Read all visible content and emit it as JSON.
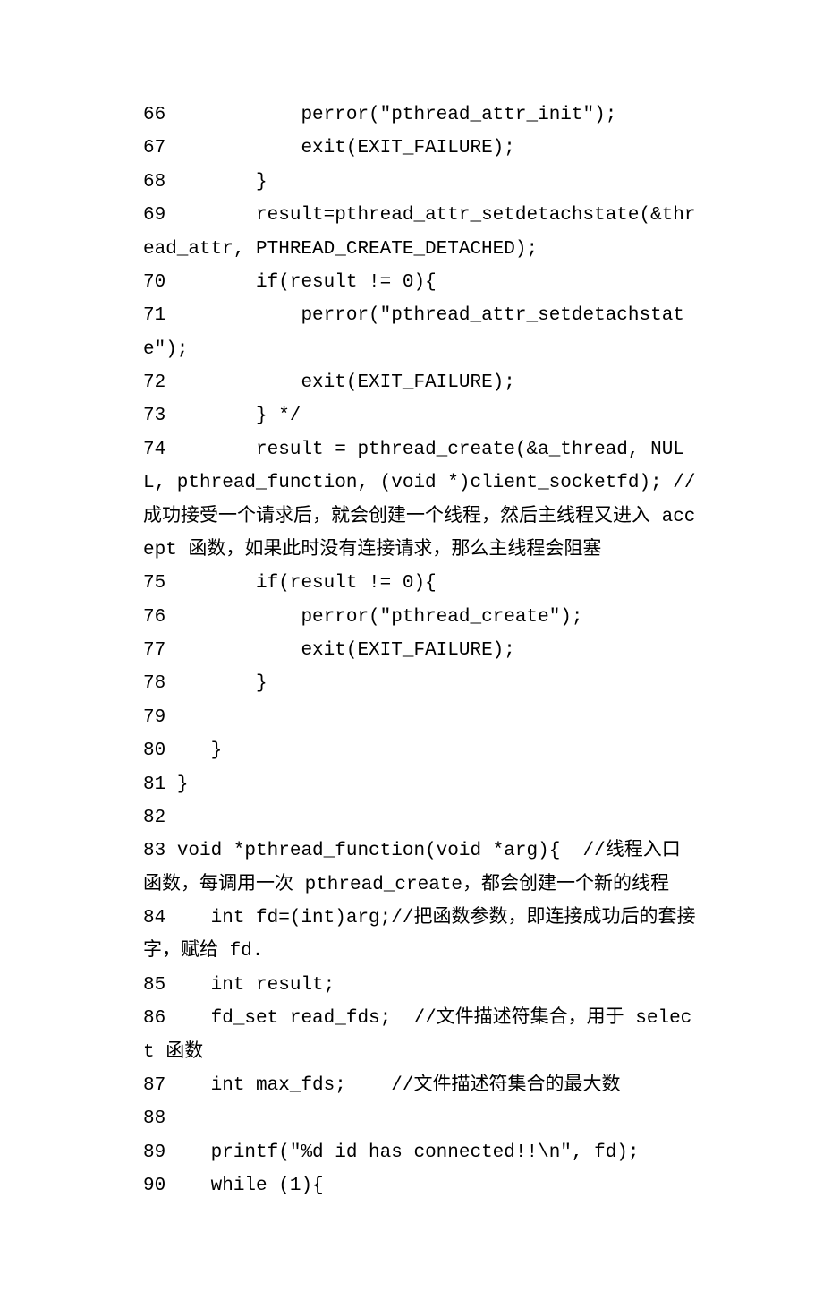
{
  "lines": [
    {
      "n": "66",
      "text": "            perror(\"pthread_attr_init\");"
    },
    {
      "n": "67",
      "text": "            exit(EXIT_FAILURE);"
    },
    {
      "n": "68",
      "text": "        }"
    },
    {
      "n": "69",
      "text": "        result=pthread_attr_setdetachstate(&thread_attr, PTHREAD_CREATE_DETACHED);"
    },
    {
      "n": "70",
      "text": "        if(result != 0){"
    },
    {
      "n": "71",
      "text": "            perror(\"pthread_attr_setdetachstate\");"
    },
    {
      "n": "72",
      "text": "            exit(EXIT_FAILURE);"
    },
    {
      "n": "73",
      "text": "        } */"
    },
    {
      "n": "74",
      "text": "        result = pthread_create(&a_thread, NULL, pthread_function, (void *)client_socketfd); //成功接受一个请求后，就会创建一个线程，然后主线程又进入 accept 函数，如果此时没有连接请求，那么主线程会阻塞"
    },
    {
      "n": "75",
      "text": "        if(result != 0){"
    },
    {
      "n": "76",
      "text": "            perror(\"pthread_create\");"
    },
    {
      "n": "77",
      "text": "            exit(EXIT_FAILURE);"
    },
    {
      "n": "78",
      "text": "        }"
    },
    {
      "n": "79",
      "text": ""
    },
    {
      "n": "80",
      "text": "    }"
    },
    {
      "n": "81",
      "text": " }"
    },
    {
      "n": "82",
      "text": ""
    },
    {
      "n": "83",
      "text": " void *pthread_function(void *arg){  //线程入口函数，每调用一次 pthread_create，都会创建一个新的线程"
    },
    {
      "n": "84",
      "text": "    int fd=(int)arg;//把函数参数，即连接成功后的套接字，赋给 fd."
    },
    {
      "n": "85",
      "text": "    int result;"
    },
    {
      "n": "86",
      "text": "    fd_set read_fds;  //文件描述符集合，用于 select 函数"
    },
    {
      "n": "87",
      "text": "    int max_fds;    //文件描述符集合的最大数"
    },
    {
      "n": "88",
      "text": ""
    },
    {
      "n": "89",
      "text": "    printf(\"%d id has connected!!\\n\", fd);"
    },
    {
      "n": "90",
      "text": "    while (1){"
    }
  ]
}
